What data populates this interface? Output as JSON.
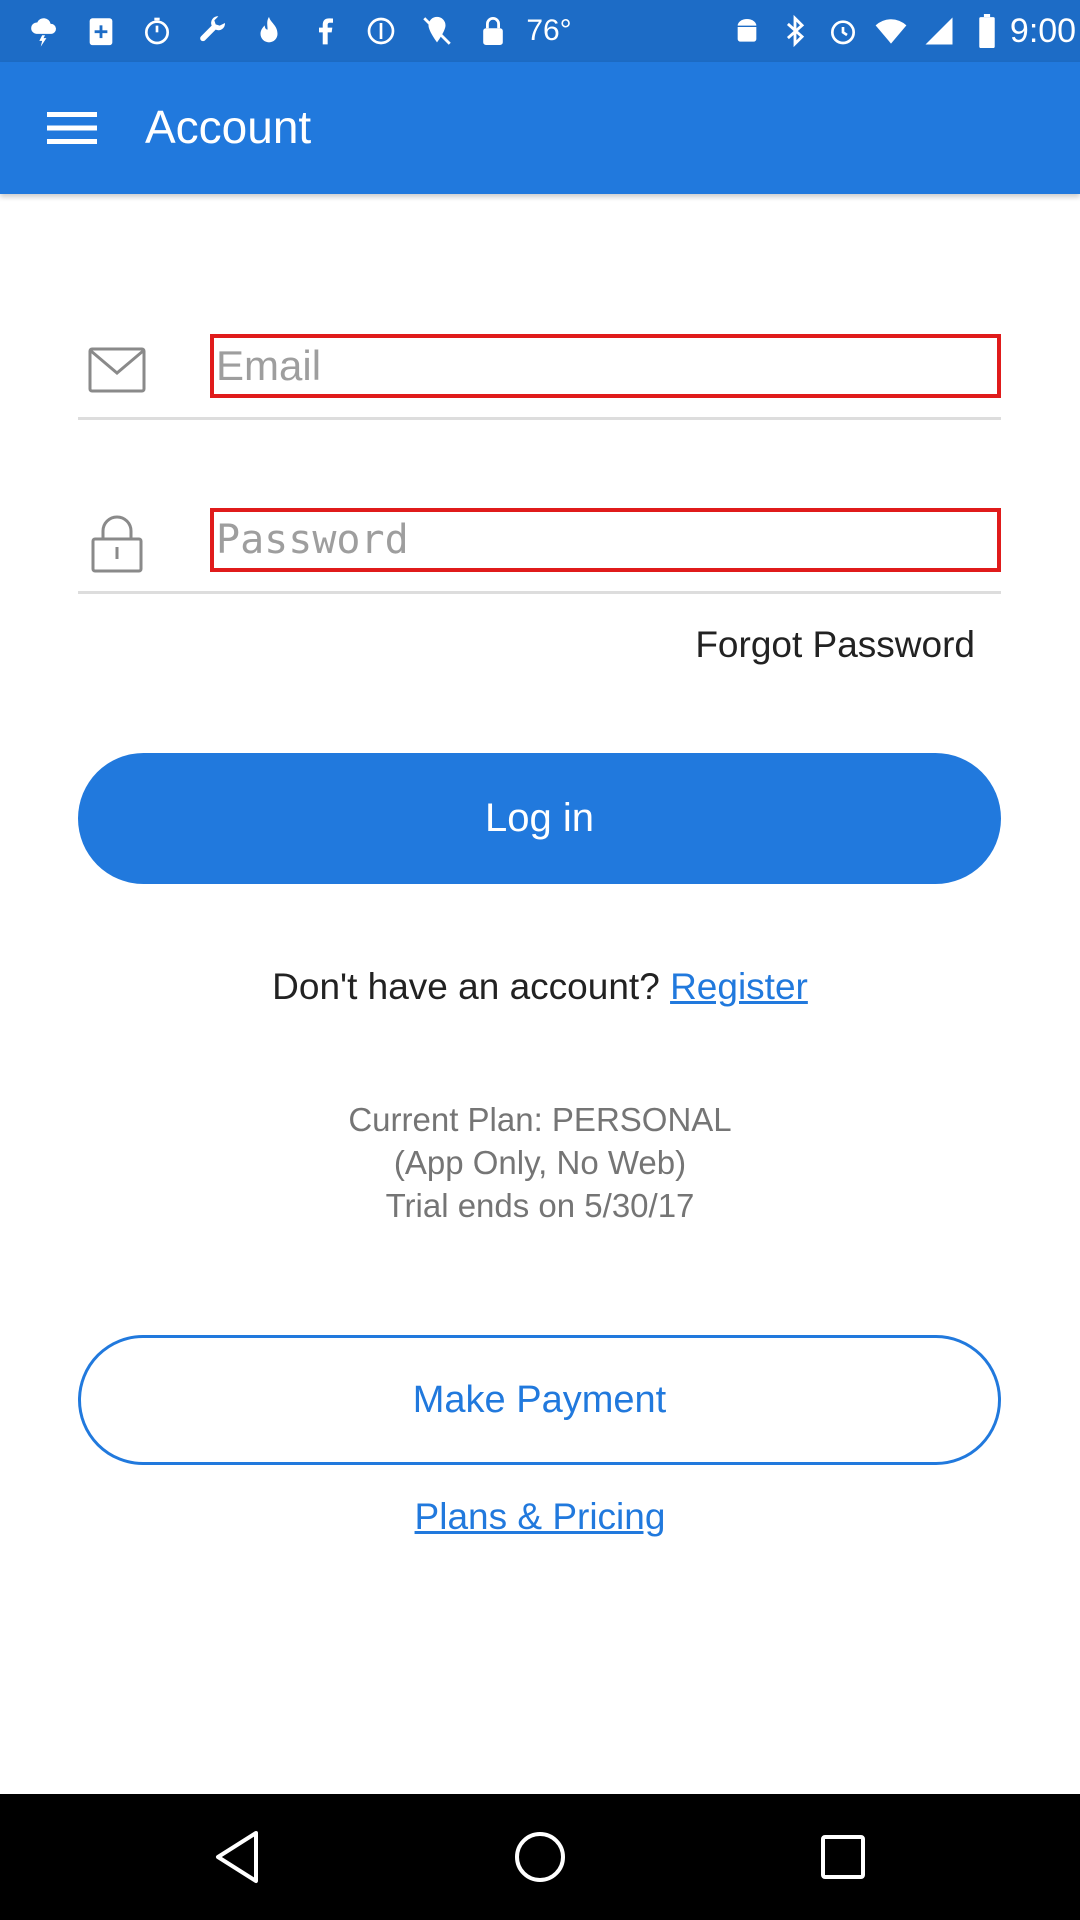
{
  "status_bar": {
    "temperature": "76°",
    "time": "9:00",
    "left_icons": [
      "thunderstorm-icon",
      "medical-kit-icon",
      "timer-icon",
      "wrench-icon",
      "flame-icon",
      "facebook-icon",
      "do-not-disturb-icon",
      "location-off-icon",
      "lock-icon"
    ],
    "right_icons": [
      "android-icon",
      "bluetooth-icon",
      "alarm-icon",
      "wifi-icon",
      "signal-icon",
      "battery-icon"
    ]
  },
  "app_bar": {
    "title": "Account",
    "menu_icon": "hamburger-menu-icon"
  },
  "form": {
    "email_placeholder": "Email",
    "email_value": "",
    "email_icon": "envelope-icon",
    "password_placeholder": "Password",
    "password_value": "",
    "password_icon": "padlock-icon",
    "forgot_password": "Forgot Password",
    "login_label": "Log in"
  },
  "register": {
    "prompt": "Don't have an account?",
    "link": "Register"
  },
  "plan": {
    "line1": "Current Plan: PERSONAL",
    "line2": "(App Only, No Web)",
    "line3": "Trial ends on 5/30/17"
  },
  "actions": {
    "make_payment": "Make Payment",
    "plans_pricing": "Plans & Pricing"
  },
  "nav_bar": {
    "back_icon": "back-triangle-icon",
    "home_icon": "home-circle-icon",
    "recent_icon": "recent-square-icon"
  },
  "colors": {
    "primary": "#2179dd",
    "status_bar": "#1d6cc6",
    "error_border": "#e01b1b"
  }
}
